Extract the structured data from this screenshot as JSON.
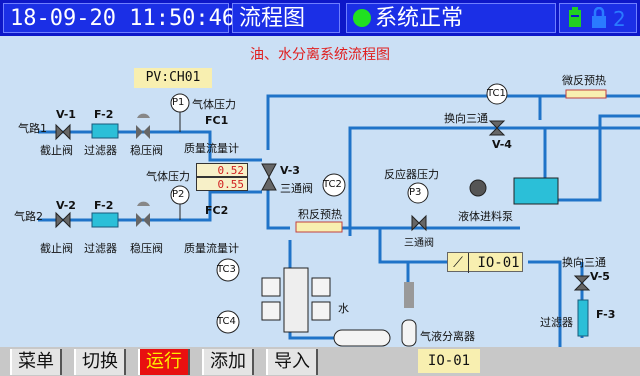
{
  "header": {
    "datetime": "18-09-20 11:50:46",
    "screen_name": "流程图",
    "status_text": "系统正常",
    "page_number": "2"
  },
  "diagram": {
    "title": "油、水分离系统流程图",
    "pv_tag": "PV:CH01",
    "gas1": {
      "line": "气路1",
      "valve_tag": "V-1",
      "filter_tag": "F-2",
      "valve_label": "截止阀",
      "filter_label": "过滤器",
      "regulator_label": "稳压阀",
      "gauge": "P1",
      "pressure_label": "气体压力",
      "fc_tag": "FC1",
      "fc_label": "质量流量计"
    },
    "gas2": {
      "line": "气路2",
      "valve_tag": "V-2",
      "filter_tag": "F-2",
      "valve_label": "截止阀",
      "filter_label": "过滤器",
      "regulator_label": "稳压阀",
      "gauge": "P2",
      "pressure_label": "气体压力",
      "fc_tag": "FC2",
      "fc_label": "质量流量计"
    },
    "pressure_values": [
      "0.52",
      "0.55"
    ],
    "three_way": {
      "tag": "V-3",
      "label": "三通阀"
    },
    "tc1": "TC1",
    "tc2": "TC2",
    "tc3": "TC3",
    "tc4": "TC4",
    "micro_preheat": "微反预热",
    "reverse_valve": {
      "label": "换向三通",
      "tag": "V-4"
    },
    "accumulate_preheat": "积反预热",
    "reactor_pressure": {
      "label": "反应器压力",
      "gauge": "P3",
      "valve_label": "三通阀"
    },
    "pump_label": "液体进料泵",
    "io_tag": "IO-01",
    "reverse_valve2": {
      "label": "换向三通",
      "tag": "V-5"
    },
    "filter3": {
      "label": "过滤器",
      "tag": "F-3"
    },
    "water_label": "水",
    "separator_label": "气液分离器"
  },
  "menu": {
    "items": [
      "菜单",
      "切换",
      "运行",
      "添加",
      "导入"
    ],
    "active_index": 2,
    "current_tag": "IO-01"
  },
  "colors": {
    "header_bg": "#0d17c8",
    "pipe": "#1f73c8",
    "status_ok": "#20e020",
    "active_button": "#e81010",
    "title_red": "#e02020"
  }
}
